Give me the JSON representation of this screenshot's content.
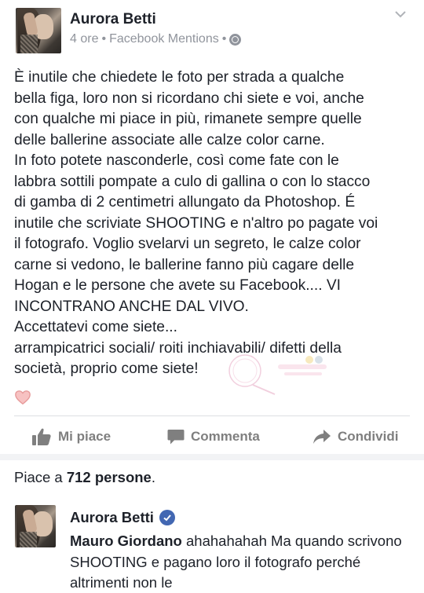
{
  "post": {
    "author": "Aurora Betti",
    "meta": {
      "time": "4 ore",
      "separator": "•",
      "source": "Facebook Mentions",
      "privacy_icon": "globe-icon"
    },
    "menu_icon": "chevron-down-icon",
    "text": "È inutile che chiedete le foto per strada a qualche\nbella figa, loro non si ricordano chi siete e voi, anche\ncon qualche mi piace in più, rimanete sempre quelle\ndelle ballerine associate alle calze color carne.\nIn foto potete nasconderle, così come fate con le\nlabbra sottili pompate a culo di gallina o con lo stacco\ndi gamba di 2 centimetri allungato da Photoshop. É\ninutile che scriviate SHOOTING e n'altro po pagate voi\nil fotografo. Voglio svelarvi un segreto, le calze color\ncarne si vedono, le ballerine fanno più cagare delle\nHogan e  le persone che avete su Facebook.... VI\nINCONTRANO ANCHE DAL VIVO.\nAccettatevi come siete...\narrampicatrici sociali/ roiti inchiavabili/ difetti della\nsocietà, proprio come siete!",
    "reaction_icon": "heart-icon"
  },
  "actions": {
    "like_label": "Mi piace",
    "comment_label": "Commenta",
    "share_label": "Condividi"
  },
  "likes": {
    "prefix": "Piace a",
    "count_text": "712 persone",
    "suffix": "."
  },
  "comment": {
    "author": "Aurora Betti",
    "verified": true,
    "mention": "Mauro Giordano",
    "text": "ahahahahah Ma quando scrivono SHOOTING e pagano loro il fotografo perché altrimenti non le"
  },
  "colors": {
    "text": "#1d2129",
    "muted": "#90949c",
    "action": "#7f7f7f",
    "verified": "#4267b2",
    "divider": "#dddfe2"
  }
}
